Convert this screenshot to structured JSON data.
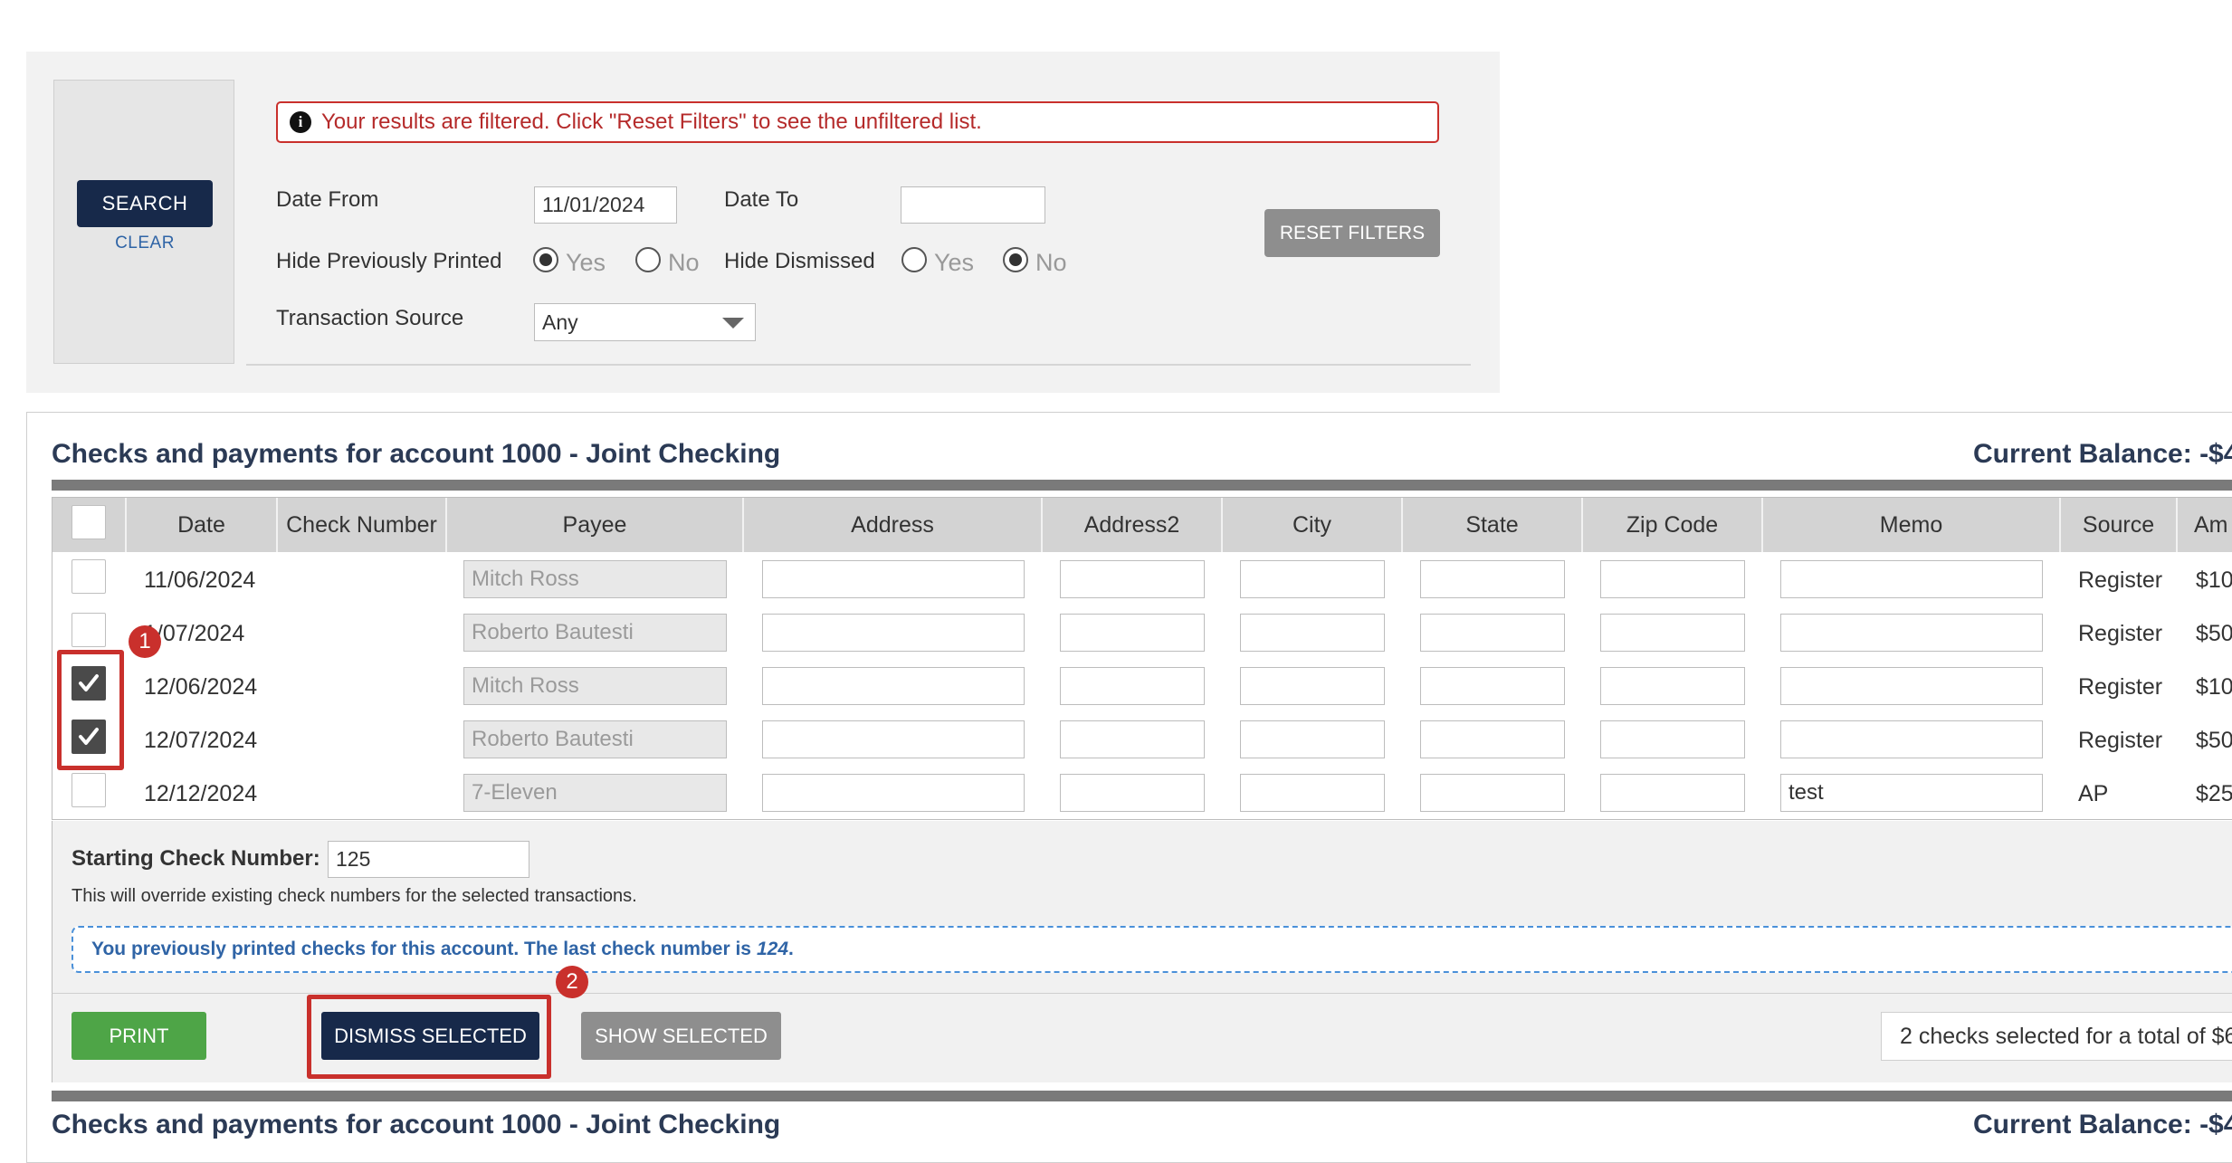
{
  "filters": {
    "search_label": "SEARCH",
    "clear_label": "CLEAR",
    "alert_icon": "i",
    "alert_text": "Your results are filtered. Click \"Reset Filters\" to see the unfiltered list.",
    "date_from_label": "Date From",
    "date_from_value": "11/01/2024",
    "date_to_label": "Date To",
    "date_to_value": "",
    "hide_printed_label": "Hide Previously Printed",
    "hide_dismissed_label": "Hide Dismissed",
    "yes_label": "Yes",
    "no_label": "No",
    "hide_printed_selected": "Yes",
    "hide_dismissed_selected": "No",
    "transaction_source_label": "Transaction Source",
    "transaction_source_value": "Any",
    "reset_label": "RESET FILTERS"
  },
  "checks": {
    "title": "Checks and payments for account 1000 - Joint Checking",
    "balance": "Current Balance: -$4",
    "columns": [
      "Date",
      "Check Number",
      "Payee",
      "Address",
      "Address2",
      "City",
      "State",
      "Zip Code",
      "Memo",
      "Source",
      "Am"
    ],
    "rows": [
      {
        "checked": false,
        "date": "11/06/2024",
        "check_number": "",
        "payee": "Mitch Ross",
        "address": "",
        "address2": "",
        "city": "",
        "state": "",
        "zip": "",
        "memo": "",
        "source": "Register",
        "amount": "$10"
      },
      {
        "checked": false,
        "date": "1/07/2024",
        "check_number": "",
        "payee": "Roberto Bautesti",
        "address": "",
        "address2": "",
        "city": "",
        "state": "",
        "zip": "",
        "memo": "",
        "source": "Register",
        "amount": "$50"
      },
      {
        "checked": true,
        "date": "12/06/2024",
        "check_number": "",
        "payee": "Mitch Ross",
        "address": "",
        "address2": "",
        "city": "",
        "state": "",
        "zip": "",
        "memo": "",
        "source": "Register",
        "amount": "$10"
      },
      {
        "checked": true,
        "date": "12/07/2024",
        "check_number": "",
        "payee": "Roberto Bautesti",
        "address": "",
        "address2": "",
        "city": "",
        "state": "",
        "zip": "",
        "memo": "",
        "source": "Register",
        "amount": "$50"
      },
      {
        "checked": false,
        "date": "12/12/2024",
        "check_number": "",
        "payee": "7-Eleven",
        "address": "",
        "address2": "",
        "city": "",
        "state": "",
        "zip": "",
        "memo": "test",
        "source": "AP",
        "amount": "$25"
      }
    ],
    "starting_check_label": "Starting Check Number:",
    "starting_check_value": "125",
    "override_note": "This will override existing check numbers for the selected transactions.",
    "printed_notice": "You previously printed checks for this account. The last check number is",
    "last_check_number": "124",
    "print_label": "PRINT",
    "dismiss_label": "DISMISS SELECTED",
    "show_selected_label": "SHOW SELECTED",
    "selection_summary": "2 checks selected for a total of $6"
  },
  "checks_repeat": {
    "title": "Checks and payments for account 1000 - Joint Checking",
    "balance": "Current Balance: -$4"
  },
  "annotations": {
    "badge1": "1",
    "badge2": "2"
  },
  "colors": {
    "primary_navy": "#17294a",
    "print_green": "#4ea547",
    "secondary_gray": "#8e8e8e",
    "alert_red": "#c9302c",
    "info_blue": "#2f64a6"
  }
}
